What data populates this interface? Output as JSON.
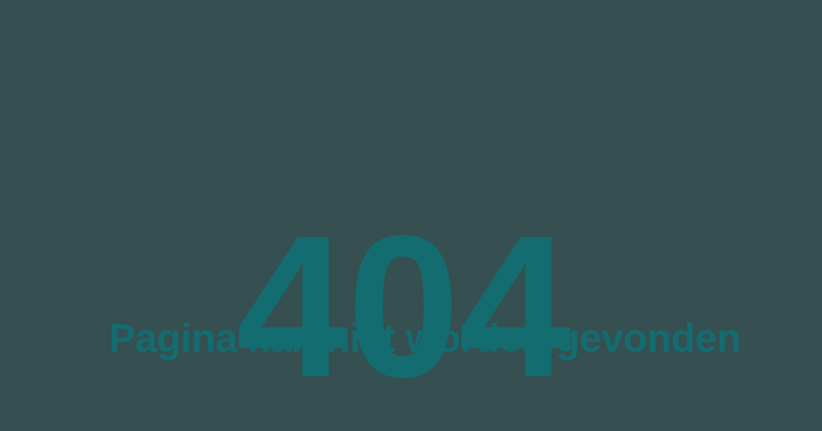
{
  "error": {
    "code": "404",
    "message": "Pagina kan niet worden gevonden"
  },
  "colors": {
    "background": "#364f50",
    "accent": "#136c70"
  }
}
